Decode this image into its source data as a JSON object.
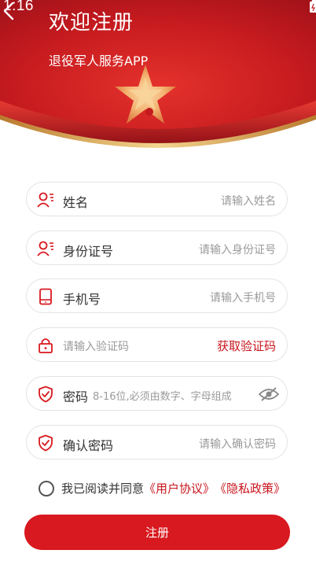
{
  "status": {
    "time": "1:16"
  },
  "header": {
    "title": "欢迎注册",
    "subtitle": "退役军人服务APP"
  },
  "form": {
    "name": {
      "label": "姓名",
      "placeholder": "请输入姓名"
    },
    "id_number": {
      "label": "身份证号",
      "placeholder": "请输入身份证号"
    },
    "phone": {
      "label": "手机号",
      "placeholder": "请输入手机号"
    },
    "code": {
      "placeholder": "请输入验证码",
      "action": "获取验证码"
    },
    "password": {
      "label": "密码",
      "placeholder": "8-16位,必须由数字、字母组成"
    },
    "confirm_password": {
      "label": "确认密码",
      "placeholder": "请输入确认密码"
    }
  },
  "agreement": {
    "text": "我已阅读并同意",
    "user_agreement": "《用户协议》",
    "privacy_policy": "《隐私政策》"
  },
  "submit_label": "注册",
  "colors": {
    "accent": "#d8191f",
    "header": "#c21a1f"
  }
}
